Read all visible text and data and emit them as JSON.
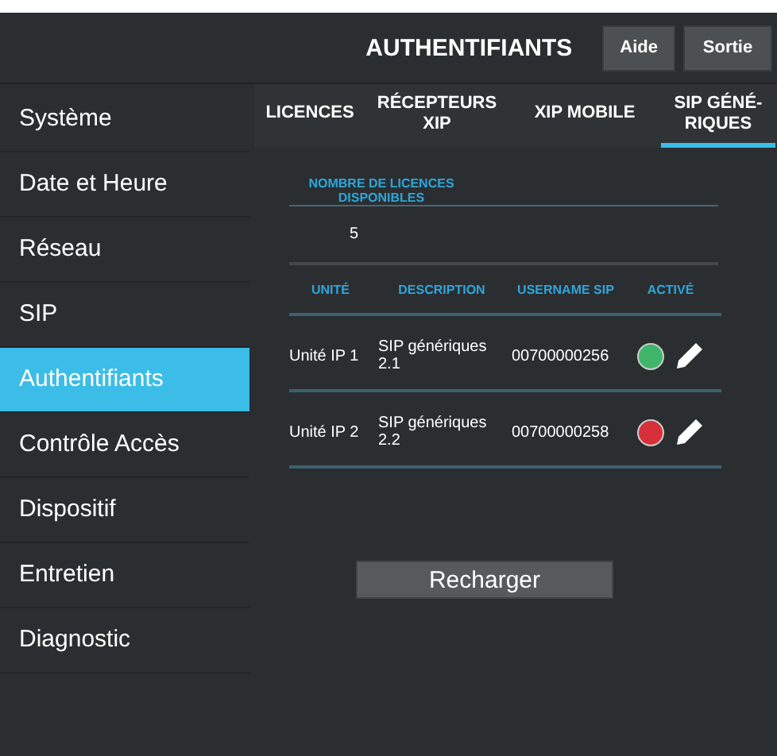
{
  "header": {
    "title": "AUTHENTIFIANTS",
    "buttons": [
      "Aide",
      "Sortie"
    ]
  },
  "sidebar": {
    "items": [
      {
        "label": "Système",
        "selected": false
      },
      {
        "label": "Date et Heure",
        "selected": false
      },
      {
        "label": "Réseau",
        "selected": false
      },
      {
        "label": "SIP",
        "selected": false
      },
      {
        "label": "Authentifiants",
        "selected": true
      },
      {
        "label": "Contrôle Accès",
        "selected": false
      },
      {
        "label": "Dispositif",
        "selected": false
      },
      {
        "label": "Entretien",
        "selected": false
      },
      {
        "label": "Diagnostic",
        "selected": false
      }
    ]
  },
  "tabs": [
    {
      "label": "LICENCES",
      "selected": false
    },
    {
      "label": "RÉCEPTEURS XIP",
      "selected": false
    },
    {
      "label": "XIP MOBILE",
      "selected": false
    },
    {
      "label": "SIP GÉNÉ-RIQUES",
      "selected": true
    }
  ],
  "licenses": {
    "label": "NOMBRE DE LICENCES DISPONIBLES",
    "value": "5"
  },
  "table": {
    "columns": [
      "UNITÉ",
      "DESCRIPTION",
      "USERNAME SIP",
      "ACTIVÉ"
    ],
    "rows": [
      {
        "unit": "Unité IP 1",
        "description": "SIP génériques 2.1",
        "username": "00700000256",
        "active": true
      },
      {
        "unit": "Unité IP 2",
        "description": "SIP génériques 2.2",
        "username": "00700000258",
        "active": false
      }
    ]
  },
  "reload_button": "Recharger"
}
